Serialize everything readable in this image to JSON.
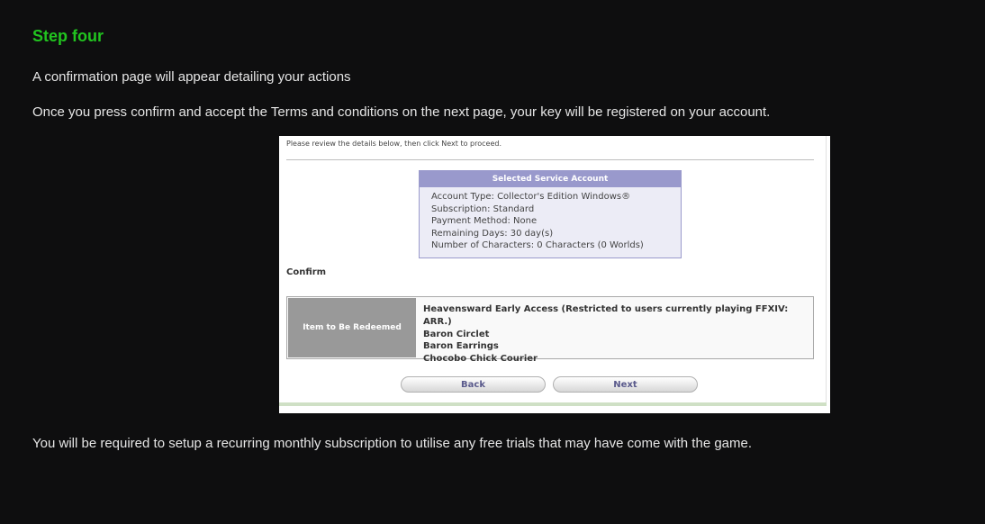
{
  "heading": "Step four",
  "paragraphs": {
    "p1": "A confirmation page will appear detailing your actions",
    "p2": "Once you press confirm and accept the Terms and conditions on the next page, your key will be registered on your account.",
    "p3": "You will be required to setup a recurring monthly subscription to utilise any free trials that may have come with the game."
  },
  "screenshot": {
    "review_text": "Please review the details below, then click Next to proceed.",
    "account": {
      "title": "Selected Service Account",
      "lines": [
        "Account Type: Collector's Edition  Windows®",
        "Subscription: Standard",
        "Payment Method: None",
        "Remaining Days: 30 day(s)",
        "Number of Characters: 0 Characters  (0 Worlds)"
      ]
    },
    "confirm_label": "Confirm",
    "items_label": "Item to Be Redeemed",
    "items": [
      "Heavensward Early Access (Restricted to users currently playing FFXIV: ARR.)",
      "Baron Circlet",
      "Baron Earrings",
      "Chocobo Chick Courier"
    ],
    "back_label": "Back",
    "next_label": "Next"
  }
}
